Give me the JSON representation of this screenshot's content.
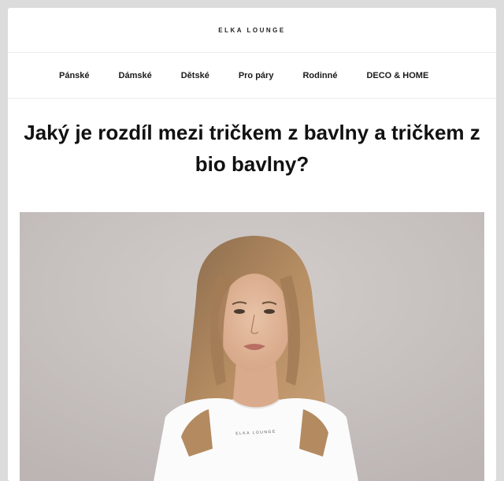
{
  "brand": "ELKA LOUNGE",
  "nav": {
    "items": [
      {
        "label": "Pánské"
      },
      {
        "label": "Dámské"
      },
      {
        "label": "Dětské"
      },
      {
        "label": "Pro páry"
      },
      {
        "label": "Rodinné"
      },
      {
        "label": "DECO & HOME"
      }
    ]
  },
  "article": {
    "title": "Jaký je rozdíl mezi tričkem z bavlny a tričkem z bio bavlny?"
  },
  "hero": {
    "shirt_print": "ELKA LOUNGE",
    "colors": {
      "background": "#c9c3c1",
      "hair": "#b78e63",
      "skin": "#e2b89a",
      "shirt": "#fbfbfb"
    }
  }
}
